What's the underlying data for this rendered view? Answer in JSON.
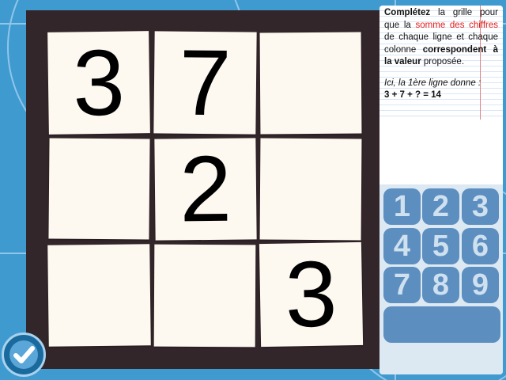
{
  "instructions": {
    "part1": "Complétez",
    "part2": " la grille pour que la ",
    "part3": "somme des chiffres",
    "part4": " de chaque ligne et chaque colonne ",
    "part5": "correspondent à la valeur",
    "part6": " proposée.",
    "example_intro": "Ici, la 1ère ligne donne :",
    "example_formula": "3 + 7 + ? = 14"
  },
  "grid": {
    "r0c0": "3",
    "r0c1": "7",
    "r0c2": "",
    "r1c0": "",
    "r1c1": "2",
    "r1c2": "",
    "r2c0": "",
    "r2c1": "",
    "r2c2": "3"
  },
  "keypad": {
    "k1": "1",
    "k2": "2",
    "k3": "3",
    "k4": "4",
    "k5": "5",
    "k6": "6",
    "k7": "7",
    "k8": "8",
    "k9": "9"
  },
  "colors": {
    "background": "#3f9ad0",
    "board": "#33262a",
    "cell": "#fdf9f0",
    "key": "#5c8ec0",
    "highlight": "#e41a1a"
  }
}
